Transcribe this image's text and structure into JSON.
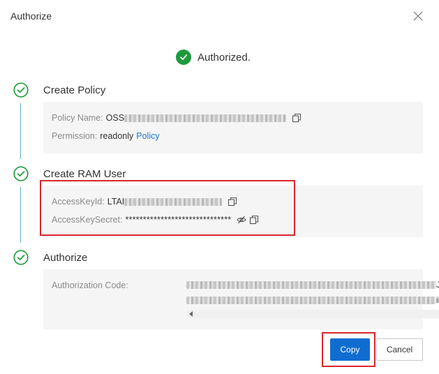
{
  "dialog": {
    "title": "Authorize"
  },
  "status": {
    "text": "Authorized."
  },
  "steps": [
    {
      "title": "Create Policy",
      "fields": [
        {
          "label": "Policy Name:",
          "value_prefix": "OSS"
        },
        {
          "label": "Permission:",
          "value": "readonly",
          "link": "Policy"
        }
      ]
    },
    {
      "title": "Create RAM User",
      "fields": [
        {
          "label": "AccessKeyId:",
          "value_prefix": "LTAI"
        },
        {
          "label": "AccessKeySecret:",
          "value": "******************************"
        }
      ]
    },
    {
      "title": "Authorize",
      "fields": [
        {
          "label": "Authorization Code:",
          "line_end_1": "JI",
          "line_end_2": "il"
        }
      ]
    }
  ],
  "buttons": {
    "copy": "Copy",
    "cancel": "Cancel"
  },
  "colors": {
    "success": "#1c9a3c",
    "primary": "#0f6dd0",
    "link": "#1b78d6",
    "highlight": "#d9262c"
  }
}
